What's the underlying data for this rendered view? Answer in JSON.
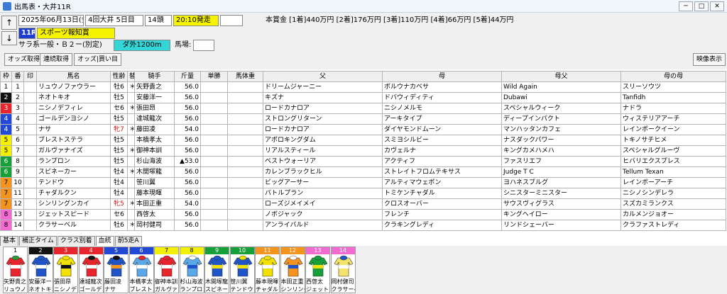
{
  "window": {
    "title": "出馬表・大井11R"
  },
  "header": {
    "date": "2025年06月13日(金)",
    "meeting": "4回大井 5日目",
    "runners": "14頭",
    "post_time": "20:10発走",
    "race_no": "11R",
    "race_name": "スポーツ報知賞",
    "conditions": "サラ系一般・Ｂ２ー(別定)",
    "course": "ダ外1200m",
    "track_label": "馬場:",
    "prize": "本賞金 [1着]440万円 [2着]176万円 [3着]110万円 [4着]66万円 [5着]44万円",
    "up_arrow": "↑",
    "down_arrow": "↓"
  },
  "toolbar": {
    "odds_get": "オッズ取得",
    "consecutive_get": "連続取得",
    "odds_buy": "オッズ|買い目",
    "video": "映像表示"
  },
  "columns": [
    "枠",
    "番",
    "印",
    "馬名",
    "性齢",
    "替",
    "騎手",
    "斤量",
    "単勝",
    "馬体重",
    "父",
    "母",
    "母父",
    "母の母"
  ],
  "gate_colors": {
    "1": "#ffffff",
    "2": "#111111",
    "3": "#e8252c",
    "4": "#2149d6",
    "5": "#f2f000",
    "6": "#16a03a",
    "7": "#f5931f",
    "8": "#f36ad0"
  },
  "rows": [
    {
      "gate": "1",
      "num": "1",
      "mark": "",
      "horse": "リュウノファウラー",
      "sex": "牡6",
      "change": "＊",
      "jockey": "矢野貴之",
      "weight": "56.0",
      "odds": "",
      "body": "",
      "sire": "ドリームジャーニー",
      "dam": "ボルウナカベサ",
      "damsire": "Wild Again",
      "granddam": "スリーソウツ",
      "sex_color": "#000"
    },
    {
      "gate": "2",
      "num": "2",
      "mark": "",
      "horse": "ネオトキオ",
      "sex": "牡5",
      "change": "",
      "jockey": "安藤洋一",
      "weight": "56.0",
      "odds": "",
      "body": "",
      "sire": "キズナ",
      "dam": "ドバウィディティ",
      "damsire": "Dubawi",
      "granddam": "Tanfidh",
      "sex_color": "#000"
    },
    {
      "gate": "3",
      "num": "3",
      "mark": "",
      "horse": "ニシノデフィレ",
      "sex": "セ6",
      "change": "＊",
      "jockey": "張田昂",
      "weight": "56.0",
      "odds": "",
      "body": "",
      "sire": "ロードカナロア",
      "dam": "ニシノメルモ",
      "damsire": "スペシャルウィーク",
      "granddam": "ナドラ",
      "sex_color": "#000"
    },
    {
      "gate": "4",
      "num": "4",
      "mark": "",
      "horse": "ゴールデンヨシノ",
      "sex": "牡5",
      "change": "",
      "jockey": "達城龍次",
      "weight": "56.0",
      "odds": "",
      "body": "",
      "sire": "ストロングリターン",
      "dam": "アーキタイプ",
      "damsire": "ディープインパクト",
      "granddam": "ウィステリアアーチ",
      "sex_color": "#000"
    },
    {
      "gate": "4",
      "num": "5",
      "mark": "",
      "horse": "ナサ",
      "sex": "牝7",
      "change": "＊",
      "jockey": "藤田凌",
      "weight": "54.0",
      "odds": "",
      "body": "",
      "sire": "ロードカナロア",
      "dam": "ダイヤモンドムーン",
      "damsire": "マンハッタンカフェ",
      "granddam": "レインボークイーン",
      "sex_color": "#d01010"
    },
    {
      "gate": "5",
      "num": "6",
      "mark": "",
      "horse": "ブレストステラ",
      "sex": "牡5",
      "change": "",
      "jockey": "本橋孝太",
      "weight": "56.0",
      "odds": "",
      "body": "",
      "sire": "アポロキングダム",
      "dam": "スミヨシルビー",
      "damsire": "ナスダックパワー",
      "granddam": "トキノサチヒメ",
      "sex_color": "#000"
    },
    {
      "gate": "5",
      "num": "7",
      "mark": "",
      "horse": "ガルヴァナイズ",
      "sex": "牡5",
      "change": "＊",
      "jockey": "御神本訓",
      "weight": "56.0",
      "odds": "",
      "body": "",
      "sire": "リアルスティール",
      "dam": "カヴェルナ",
      "damsire": "キングカメハメハ",
      "granddam": "スペシャルグルーヴ",
      "sex_color": "#000"
    },
    {
      "gate": "6",
      "num": "8",
      "mark": "",
      "horse": "ランプロン",
      "sex": "牡5",
      "change": "",
      "jockey": "杉山海波",
      "weight": "▲53.0",
      "odds": "",
      "body": "",
      "sire": "ベストウォーリア",
      "dam": "アクティフ",
      "damsire": "ファスリエフ",
      "granddam": "ヒバリエクスプレス",
      "sex_color": "#000"
    },
    {
      "gate": "6",
      "num": "9",
      "mark": "",
      "horse": "スピネーカー",
      "sex": "牡4",
      "change": "＊",
      "jockey": "木間塚龍",
      "weight": "56.0",
      "odds": "",
      "body": "",
      "sire": "カレンブラックヒル",
      "dam": "ストレイトフロムテキサス",
      "damsire": "Judge T C",
      "granddam": "Tellum Texan",
      "sex_color": "#000"
    },
    {
      "gate": "7",
      "num": "10",
      "mark": "",
      "horse": "テンドウ",
      "sex": "牡4",
      "change": "",
      "jockey": "笹川翼",
      "weight": "56.0",
      "odds": "",
      "body": "",
      "sire": "ビッグアーサー",
      "dam": "アルティマウェポン",
      "damsire": "ヨハネスブルグ",
      "granddam": "レインボーアーチ",
      "sex_color": "#000"
    },
    {
      "gate": "7",
      "num": "11",
      "mark": "",
      "horse": "チャダルクン",
      "sex": "牡4",
      "change": "",
      "jockey": "藤本現暉",
      "weight": "56.0",
      "odds": "",
      "body": "",
      "sire": "バトルプラン",
      "dam": "トミケンチャダル",
      "damsire": "シニスターミニスター",
      "granddam": "ニシノシンデレラ",
      "sex_color": "#000"
    },
    {
      "gate": "7",
      "num": "12",
      "mark": "",
      "horse": "シンリングンカイ",
      "sex": "牝5",
      "change": "＊",
      "jockey": "本田正重",
      "weight": "54.0",
      "odds": "",
      "body": "",
      "sire": "ローズジメイメイ",
      "dam": "クロスオーバー",
      "damsire": "サウスヴィグラス",
      "granddam": "スズカミランクス",
      "sex_color": "#d01010"
    },
    {
      "gate": "8",
      "num": "13",
      "mark": "",
      "horse": "ジェットスピード",
      "sex": "セ6",
      "change": "",
      "jockey": "西啓太",
      "weight": "56.0",
      "odds": "",
      "body": "",
      "sire": "ノボジャック",
      "dam": "フレンチ",
      "damsire": "キングヘイロー",
      "granddam": "カルメンジョオー",
      "sex_color": "#000"
    },
    {
      "gate": "8",
      "num": "14",
      "mark": "",
      "horse": "クラサーベル",
      "sex": "牡6",
      "change": "＊",
      "jockey": "岡村健司",
      "weight": "56.0",
      "odds": "",
      "body": "",
      "sire": "アンライバルド",
      "dam": "クラキングレディ",
      "damsire": "リンドシェーバー",
      "granddam": "クラファストレディ",
      "sex_color": "#000"
    }
  ],
  "tabs": [
    "基本",
    "補正タイム",
    "クラス別着",
    "血統",
    "前5走A"
  ],
  "silks": [
    {
      "num": "1",
      "jockey": "矢野貴之",
      "horse": "リュウノフ",
      "band": "#ffffff",
      "colors": [
        "#e8252c",
        "#ffffff",
        "#2a9a3a"
      ]
    },
    {
      "num": "2",
      "jockey": "安藤洋一",
      "horse": "ネオトキオ",
      "band": "#111111",
      "colors": [
        "#1f55c9",
        "#ffffff",
        "#1f55c9"
      ]
    },
    {
      "num": "3",
      "jockey": "張田昂",
      "horse": "ニシノデフ",
      "band": "#e8252c",
      "colors": [
        "#f2e000",
        "#111111",
        "#f2e000"
      ]
    },
    {
      "num": "4",
      "jockey": "達城龍次",
      "horse": "ゴールデン",
      "band": "#e8252c",
      "colors": [
        "#e8252c",
        "#ffffff",
        "#111111"
      ]
    },
    {
      "num": "5",
      "jockey": "藤田凌",
      "horse": "ナサ",
      "band": "#2149d6",
      "colors": [
        "#1f55c9",
        "#f5931f",
        "#111111"
      ]
    },
    {
      "num": "6",
      "jockey": "本橋孝太",
      "horse": "ブレストス",
      "band": "#2149d6",
      "colors": [
        "#5aa8e8",
        "#ffffff",
        "#e8252c"
      ]
    },
    {
      "num": "7",
      "jockey": "御神本訓",
      "horse": "ガルヴァナ",
      "band": "#f2f000",
      "colors": [
        "#e8252c",
        "#ffffff",
        "#e8252c"
      ]
    },
    {
      "num": "8",
      "jockey": "杉山海波",
      "horse": "ランプロン",
      "band": "#f2f000",
      "colors": [
        "#5aa8e8",
        "#1f55c9",
        "#ffffff"
      ]
    },
    {
      "num": "9",
      "jockey": "木間塚龍",
      "horse": "スピネーカ",
      "band": "#16a03a",
      "colors": [
        "#1f55c9",
        "#f2e000",
        "#1f55c9"
      ]
    },
    {
      "num": "10",
      "jockey": "笹川翼",
      "horse": "テンドウ",
      "band": "#16a03a",
      "colors": [
        "#1f55c9",
        "#f2e000",
        "#f2e000"
      ]
    },
    {
      "num": "11",
      "jockey": "藤本現暉",
      "horse": "チャダルク",
      "band": "#f5931f",
      "colors": [
        "#f2e000",
        "#ffffff",
        "#f2e000"
      ]
    },
    {
      "num": "12",
      "jockey": "本田正重",
      "horse": "シンリング",
      "band": "#f5931f",
      "colors": [
        "#f5931f",
        "#1f55c9",
        "#ffffff"
      ]
    },
    {
      "num": "13",
      "jockey": "西啓太",
      "horse": "ジェットス",
      "band": "#f36ad0",
      "colors": [
        "#16a03a",
        "#f2e000",
        "#16a03a"
      ]
    },
    {
      "num": "14",
      "jockey": "岡村健司",
      "horse": "クラサーベ",
      "band": "#f36ad0",
      "colors": [
        "#f5e26a",
        "#ffffff",
        "#1f55c9"
      ]
    }
  ]
}
